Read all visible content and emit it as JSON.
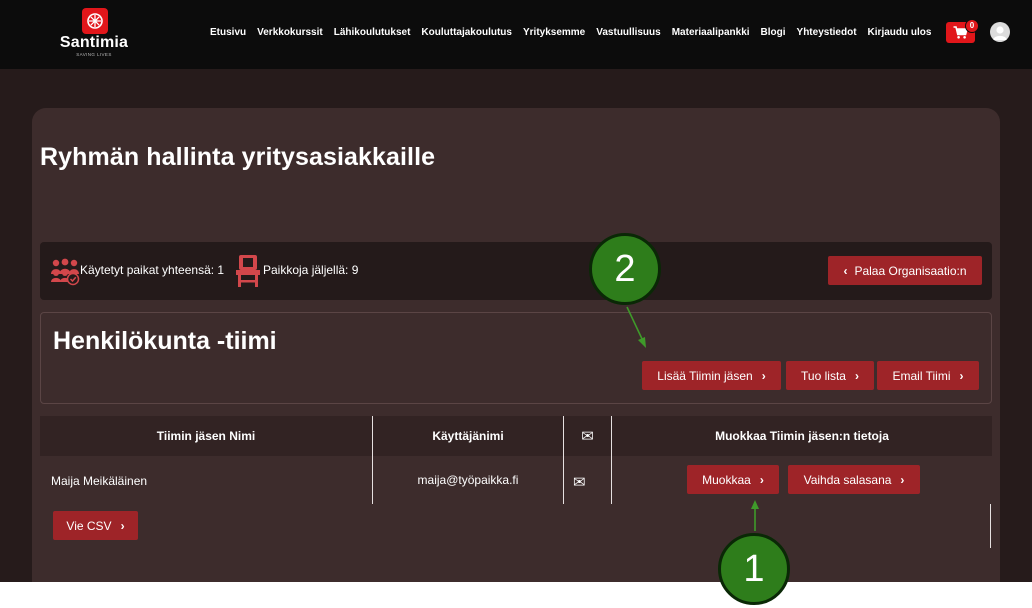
{
  "brand": {
    "name": "Santimia",
    "tagline": "SAVING LIVES"
  },
  "nav": [
    "Etusivu",
    "Verkkokurssit",
    "Lähikoulutukset",
    "Kouluttajakoulutus",
    "Yrityksemme",
    "Vastuullisuus",
    "Materiaalipankki",
    "Blogi",
    "Yhteystiedot",
    "Kirjaudu ulos"
  ],
  "cart": {
    "count": "0"
  },
  "page": {
    "title": "Ryhmän hallinta yritysasiakkaille"
  },
  "seats": {
    "used_label": "Käytetyt paikat yhteensä: 1",
    "remaining_label": "Paikkoja jäljellä: 9",
    "back_button": "Palaa Organisaatio:n"
  },
  "team": {
    "title": "Henkilökunta -tiimi",
    "add_member_button": "Lisää Tiimin jäsen",
    "import_button": "Tuo lista",
    "email_team_button": "Email Tiimi"
  },
  "table": {
    "headers": [
      "Tiimin jäsen Nimi",
      "Käyttäjänimi",
      "✉",
      "Muokkaa Tiimin jäsen:n tietoja"
    ],
    "rows": [
      {
        "name": "Maija Meikäläinen",
        "username": "maija@työpaikka.fi",
        "mail": "✉",
        "edit_button": "Muokkaa",
        "password_button": "Vaihda salasana"
      }
    ],
    "export_button": "Vie CSV"
  },
  "callouts": [
    "1",
    "2"
  ],
  "colors": {
    "accent": "#9e2428",
    "brand_red": "#e1161a",
    "callout_green": "#2e7d1b",
    "arrow_green": "#3f9a2a",
    "background": "#261b1b",
    "card": "#3d2c2c"
  }
}
